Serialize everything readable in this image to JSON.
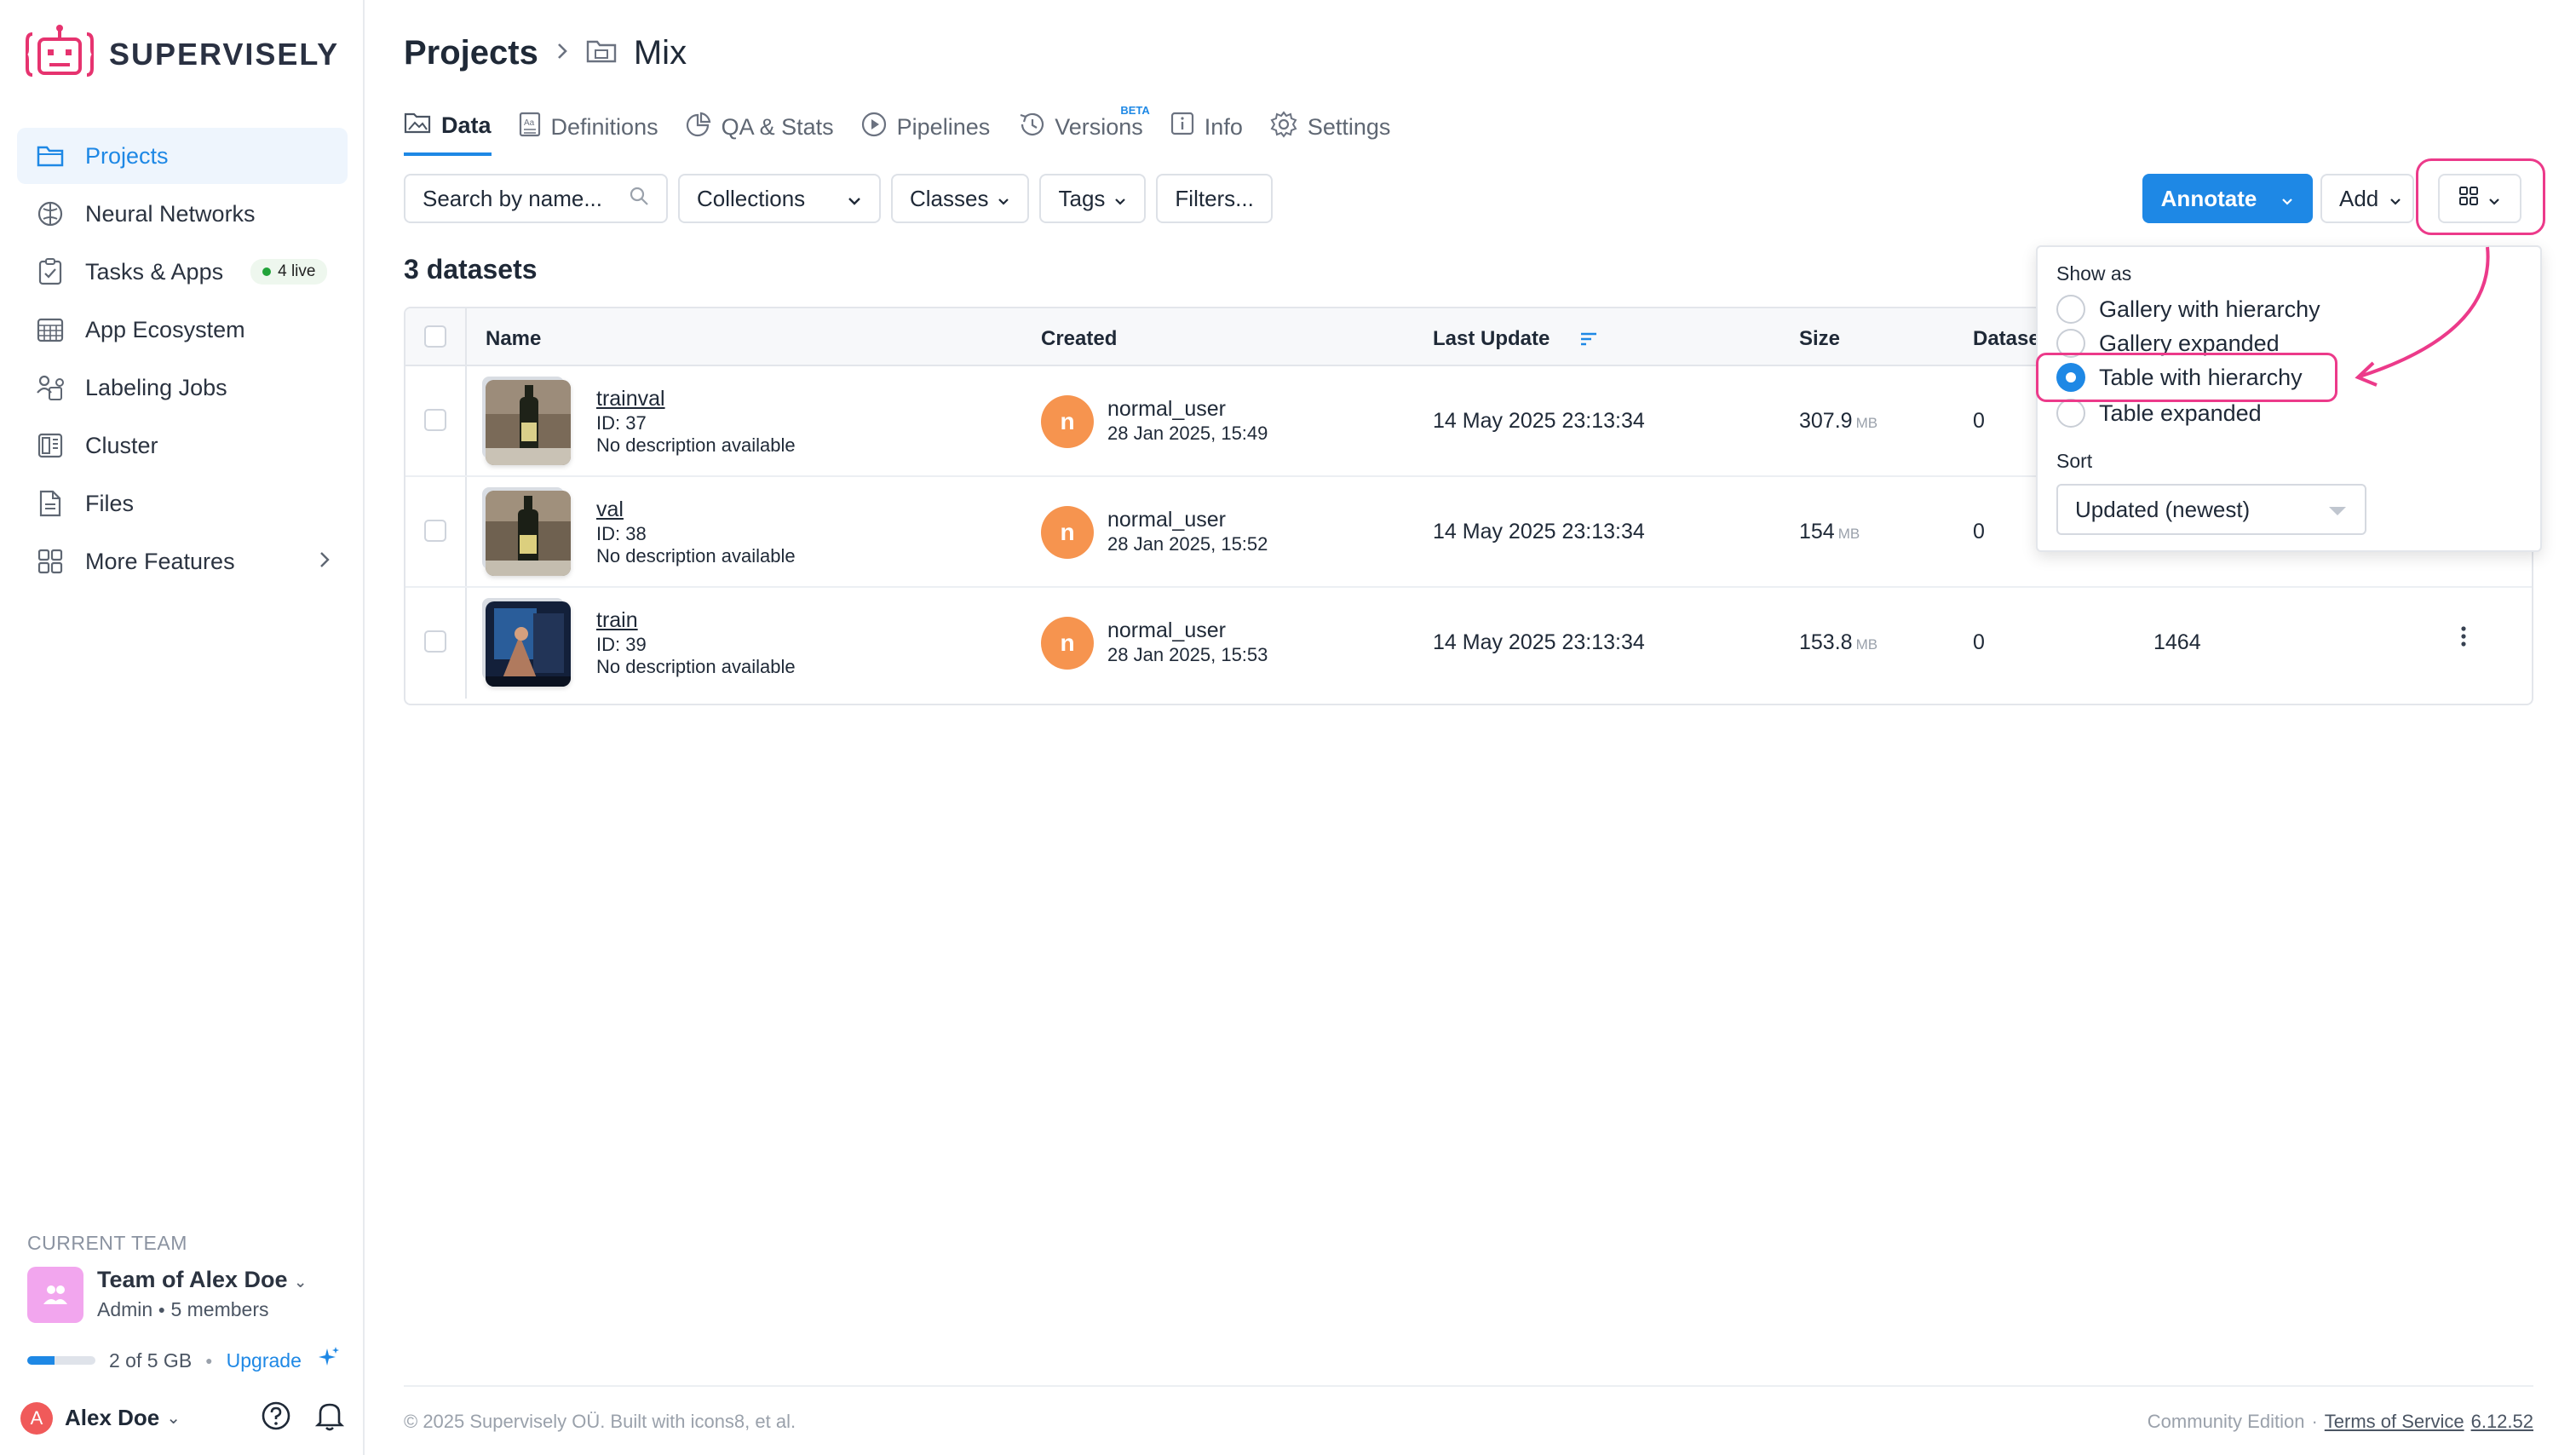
{
  "brand": {
    "name": "SUPERVISELY",
    "accent": "#1e88e5",
    "logo_color": "#e6336f"
  },
  "sidebar": {
    "items": [
      {
        "label": "Projects",
        "icon": "folder-icon",
        "active": true
      },
      {
        "label": "Neural Networks",
        "icon": "brain-icon"
      },
      {
        "label": "Tasks & Apps",
        "icon": "clipboard-icon",
        "badge": "4 live"
      },
      {
        "label": "App Ecosystem",
        "icon": "grid-calendar-icon"
      },
      {
        "label": "Labeling Jobs",
        "icon": "labeling-icon"
      },
      {
        "label": "Cluster",
        "icon": "cluster-icon"
      },
      {
        "label": "Files",
        "icon": "file-icon"
      },
      {
        "label": "More Features",
        "icon": "apps-icon"
      }
    ],
    "team": {
      "label": "CURRENT TEAM",
      "name": "Team of Alex Doe",
      "role": "Admin",
      "members": "5 members",
      "storage": "2 of 5 GB",
      "storage_fraction": 0.4,
      "upgrade": "Upgrade"
    },
    "user": {
      "initial": "A",
      "name": "Alex Doe"
    }
  },
  "breadcrumb": {
    "root": "Projects",
    "current": "Mix"
  },
  "tabs": [
    {
      "label": "Data",
      "icon": "image-icon",
      "active": true
    },
    {
      "label": "Definitions",
      "icon": "definitions-icon"
    },
    {
      "label": "QA & Stats",
      "icon": "pie-chart-icon"
    },
    {
      "label": "Pipelines",
      "icon": "play-circle-icon"
    },
    {
      "label": "Versions",
      "icon": "history-icon",
      "badge": "BETA"
    },
    {
      "label": "Info",
      "icon": "info-icon"
    },
    {
      "label": "Settings",
      "icon": "gear-icon"
    }
  ],
  "toolbar": {
    "search_placeholder": "Search by name...",
    "collections": "Collections",
    "classes": "Classes",
    "tags": "Tags",
    "filters": "Filters...",
    "annotate": "Annotate",
    "add": "Add"
  },
  "dataset_count": "3 datasets",
  "table": {
    "columns": [
      "Name",
      "Created",
      "Last Update",
      "Size",
      "Datase",
      ""
    ],
    "rows": [
      {
        "name": "trainval",
        "id": "ID: 37",
        "desc": "No description available",
        "avatar": "n",
        "user": "normal_user",
        "created": "28 Jan 2025, 15:49",
        "updated": "14 May 2025 23:13:34",
        "size": "307.9",
        "unit": "MB",
        "datasets": "0",
        "items": ""
      },
      {
        "name": "val",
        "id": "ID: 38",
        "desc": "No description available",
        "avatar": "n",
        "user": "normal_user",
        "created": "28 Jan 2025, 15:52",
        "updated": "14 May 2025 23:13:34",
        "size": "154",
        "unit": "MB",
        "datasets": "0",
        "items": ""
      },
      {
        "name": "train",
        "id": "ID: 39",
        "desc": "No description available",
        "avatar": "n",
        "user": "normal_user",
        "created": "28 Jan 2025, 15:53",
        "updated": "14 May 2025 23:13:34",
        "size": "153.8",
        "unit": "MB",
        "datasets": "0",
        "items": "1464"
      }
    ]
  },
  "view_popover": {
    "show_as_label": "Show as",
    "options": [
      "Gallery with hierarchy",
      "Gallery expanded",
      "Table with hierarchy",
      "Table expanded"
    ],
    "selected": "Table with hierarchy",
    "sort_label": "Sort",
    "sort_value": "Updated (newest)"
  },
  "footer": {
    "copyright": "© 2025 Supervisely OÜ. Built with icons8, et al.",
    "edition": "Community Edition",
    "sep": "·",
    "terms": "Terms of Service",
    "version": "6.12.52"
  }
}
